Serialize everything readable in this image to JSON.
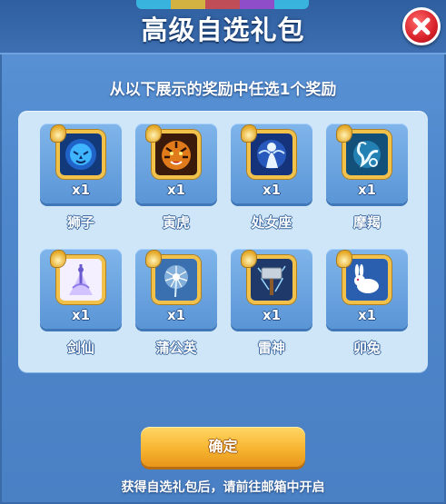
{
  "dialog": {
    "title": "高级自选礼包",
    "subtitle": "从以下展示的奖励中任选1个奖励",
    "confirm_label": "确定",
    "footer_note": "获得自选礼包后，请前往邮箱中开启",
    "close_icon": "close-icon"
  },
  "rewards": [
    {
      "name": "狮子",
      "qty": "x1",
      "icon": "lion-icon"
    },
    {
      "name": "寅虎",
      "qty": "x1",
      "icon": "tiger-icon"
    },
    {
      "name": "处女座",
      "qty": "x1",
      "icon": "virgo-icon"
    },
    {
      "name": "摩羯",
      "qty": "x1",
      "icon": "capricorn-icon"
    },
    {
      "name": "剑仙",
      "qty": "x1",
      "icon": "sword-immortal-icon"
    },
    {
      "name": "蒲公英",
      "qty": "x1",
      "icon": "dandelion-icon"
    },
    {
      "name": "雷神",
      "qty": "x1",
      "icon": "thunder-hammer-icon"
    },
    {
      "name": "卯兔",
      "qty": "x1",
      "icon": "rabbit-icon"
    }
  ],
  "colors": {
    "panel": "#4f87cc",
    "grid_bg": "#cfe6f8",
    "card": "#6ea6e2",
    "frame_gold": "#f2c14a",
    "confirm": "#f7b530",
    "close": "#d8222a"
  }
}
